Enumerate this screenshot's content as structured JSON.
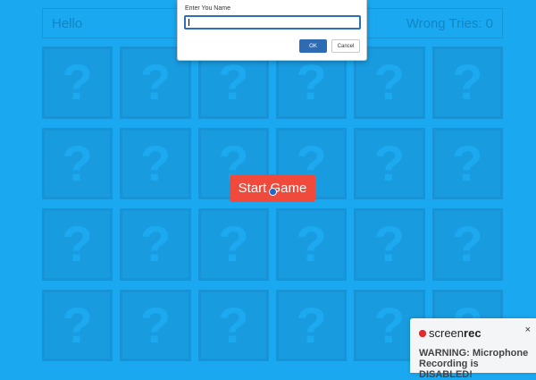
{
  "topbar": {
    "greeting": "Hello",
    "wrong_tries_label": "Wrong Tries: 0"
  },
  "grid": {
    "card_symbol": "?",
    "cards": [
      "?",
      "?",
      "?",
      "?",
      "?",
      "?",
      "?",
      "?",
      "?",
      "?",
      "?",
      "?",
      "?",
      "?",
      "?",
      "?",
      "?",
      "?",
      "?",
      "?",
      "?",
      "?",
      "?",
      "?"
    ]
  },
  "start_button": {
    "label": "Start Game"
  },
  "dialog": {
    "title": "Enter You Name",
    "input_value": "",
    "ok_label": "OK",
    "cancel_label": "Cancel"
  },
  "toast": {
    "brand_screen": "screen",
    "brand_rec": "rec",
    "close": "×",
    "message": "WARNING: Microphone Recording is DISABLED!"
  },
  "colors": {
    "background": "#1aa8f0",
    "card": "#199be0",
    "start_button": "#ef4a3b",
    "ok_button": "#2d6bb5"
  },
  "icons": {
    "cursor": "pointer-cursor-icon",
    "record": "record-dot-icon",
    "close": "close-icon"
  }
}
